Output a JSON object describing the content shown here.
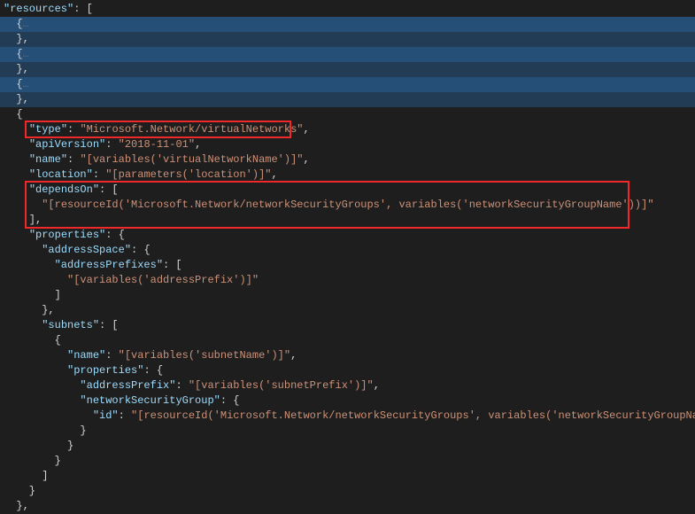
{
  "code": {
    "l1_key": "\"resources\"",
    "l1_after": ": [",
    "l2": "  {",
    "l2_fold": "…",
    "l3": "  },",
    "l4": "  {",
    "l4_fold": "…",
    "l5": "  },",
    "l6": "  {",
    "l6_fold": "…",
    "l7": "  },",
    "l8": "  {",
    "l9_pre": "    ",
    "l9_key": "\"type\"",
    "l9_sep": ": ",
    "l9_val": "\"Microsoft.Network/virtualNetworks\"",
    "l9_end": ",",
    "l10_pre": "    ",
    "l10_key": "\"apiVersion\"",
    "l10_sep": ": ",
    "l10_val": "\"2018-11-01\"",
    "l10_end": ",",
    "l11_pre": "    ",
    "l11_key": "\"name\"",
    "l11_sep": ": ",
    "l11_val": "\"[variables('virtualNetworkName')]\"",
    "l11_end": ",",
    "l12_pre": "    ",
    "l12_key": "\"location\"",
    "l12_sep": ": ",
    "l12_val": "\"[parameters('location')]\"",
    "l12_end": ",",
    "l13_pre": "    ",
    "l13_key": "\"dependsOn\"",
    "l13_sep": ": [",
    "l14_pre": "      ",
    "l14_val": "\"[resourceId('Microsoft.Network/networkSecurityGroups', variables('networkSecurityGroupName'))]\"",
    "l15": "    ],",
    "l16_pre": "    ",
    "l16_key": "\"properties\"",
    "l16_sep": ": {",
    "l17_pre": "      ",
    "l17_key": "\"addressSpace\"",
    "l17_sep": ": {",
    "l18_pre": "        ",
    "l18_key": "\"addressPrefixes\"",
    "l18_sep": ": [",
    "l19_pre": "          ",
    "l19_val": "\"[variables('addressPrefix')]\"",
    "l20": "        ]",
    "l21": "      },",
    "l22_pre": "      ",
    "l22_key": "\"subnets\"",
    "l22_sep": ": [",
    "l23": "        {",
    "l24_pre": "          ",
    "l24_key": "\"name\"",
    "l24_sep": ": ",
    "l24_val": "\"[variables('subnetName')]\"",
    "l24_end": ",",
    "l25_pre": "          ",
    "l25_key": "\"properties\"",
    "l25_sep": ": {",
    "l26_pre": "            ",
    "l26_key": "\"addressPrefix\"",
    "l26_sep": ": ",
    "l26_val": "\"[variables('subnetPrefix')]\"",
    "l26_end": ",",
    "l27_pre": "            ",
    "l27_key": "\"networkSecurityGroup\"",
    "l27_sep": ": {",
    "l28_pre": "              ",
    "l28_key": "\"id\"",
    "l28_sep": ": ",
    "l28_val": "\"[resourceId('Microsoft.Network/networkSecurityGroups', variables('networkSecurityGroupName'))]\"",
    "l29": "            }",
    "l30": "          }",
    "l31": "        }",
    "l32": "      ]",
    "l33": "    }",
    "l34": "  },"
  }
}
